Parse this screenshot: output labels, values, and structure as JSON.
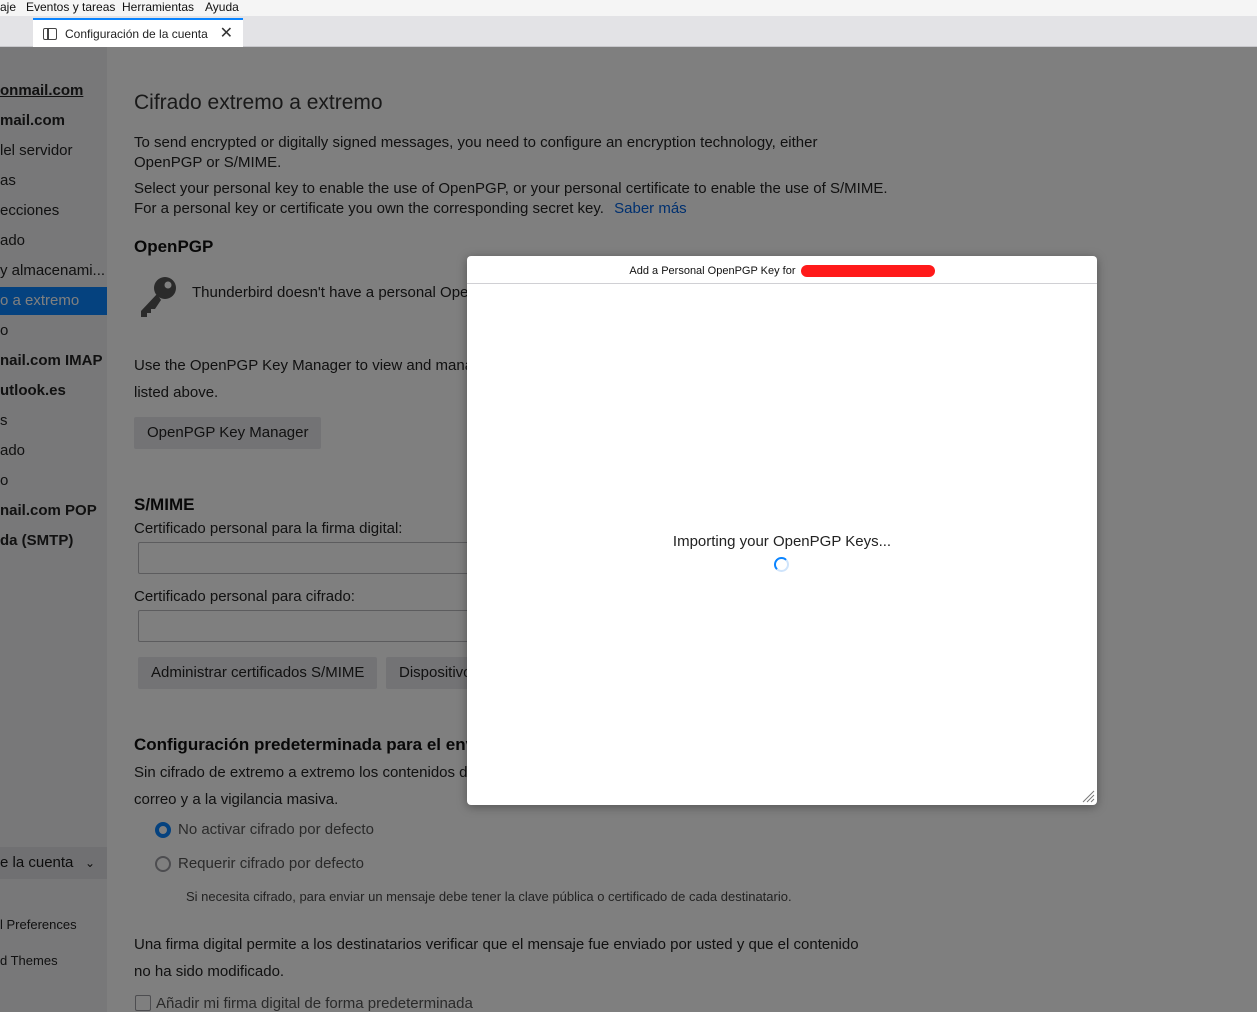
{
  "menubar": {
    "items": [
      "aje",
      "Eventos y tareas",
      "Herramientas",
      "Ayuda"
    ]
  },
  "tab": {
    "label": "Configuración de la cuenta",
    "close": "✕"
  },
  "sidebar": {
    "items": [
      "onmail.com",
      "mail.com",
      "lel servidor",
      "as",
      "ecciones",
      "ado",
      "y almacenami...",
      "o a extremo",
      "o",
      "nail.com IMAP",
      "utlook.es",
      "s",
      "ado",
      "o",
      "nail.com POP",
      "da (SMTP)"
    ],
    "account_settings": "e la cuenta",
    "preferences": "l Preferences",
    "themes": "d Themes"
  },
  "main": {
    "title": "Cifrado extremo a extremo",
    "intro_line1": "To send encrypted or digitally signed messages, you need to configure an encryption technology, either",
    "intro_line2": "OpenPGP or S/MIME.",
    "intro_line3": "Select your personal key to enable the use of OpenPGP, or your personal certificate to enable the use of S/MIME.",
    "intro_line4": "For a personal key or certificate you own the corresponding secret key.",
    "learn_more": "Saber más",
    "openpgp_heading": "OpenPGP",
    "no_key_text": "Thunderbird doesn't have a personal Oper",
    "manager_line1": "Use the OpenPGP Key Manager to view and manag",
    "manager_line2": "listed above.",
    "key_manager_button": "OpenPGP Key Manager",
    "smime_heading": "S/MIME",
    "sign_cert_label": "Certificado personal para la firma digital:",
    "encrypt_cert_label": "Certificado personal para cifrado:",
    "manage_certs_button": "Administrar certificados S/MIME",
    "devices_button": "Dispositivo",
    "defaults_heading": "Configuración predeterminada para el envío",
    "defaults_line1": "Sin cifrado de extremo a extremo los contenidos d",
    "defaults_line2": "correo y a la vigilancia masiva.",
    "radio_no_encrypt": "No activar cifrado por defecto",
    "radio_require_encrypt": "Requerir cifrado por defecto",
    "require_note": "Si necesita cifrado, para enviar un mensaje debe tener la clave pública o certificado de cada destinatario.",
    "signature_line1": "Una firma digital permite a los destinatarios verificar que el mensaje fue enviado por usted y que el contenido",
    "signature_line2": "no ha sido modificado.",
    "sign_default_checkbox": "Añadir mi firma digital de forma predeterminada"
  },
  "dialog": {
    "title": "Add a Personal OpenPGP Key for",
    "loading": "Importing your OpenPGP Keys..."
  }
}
